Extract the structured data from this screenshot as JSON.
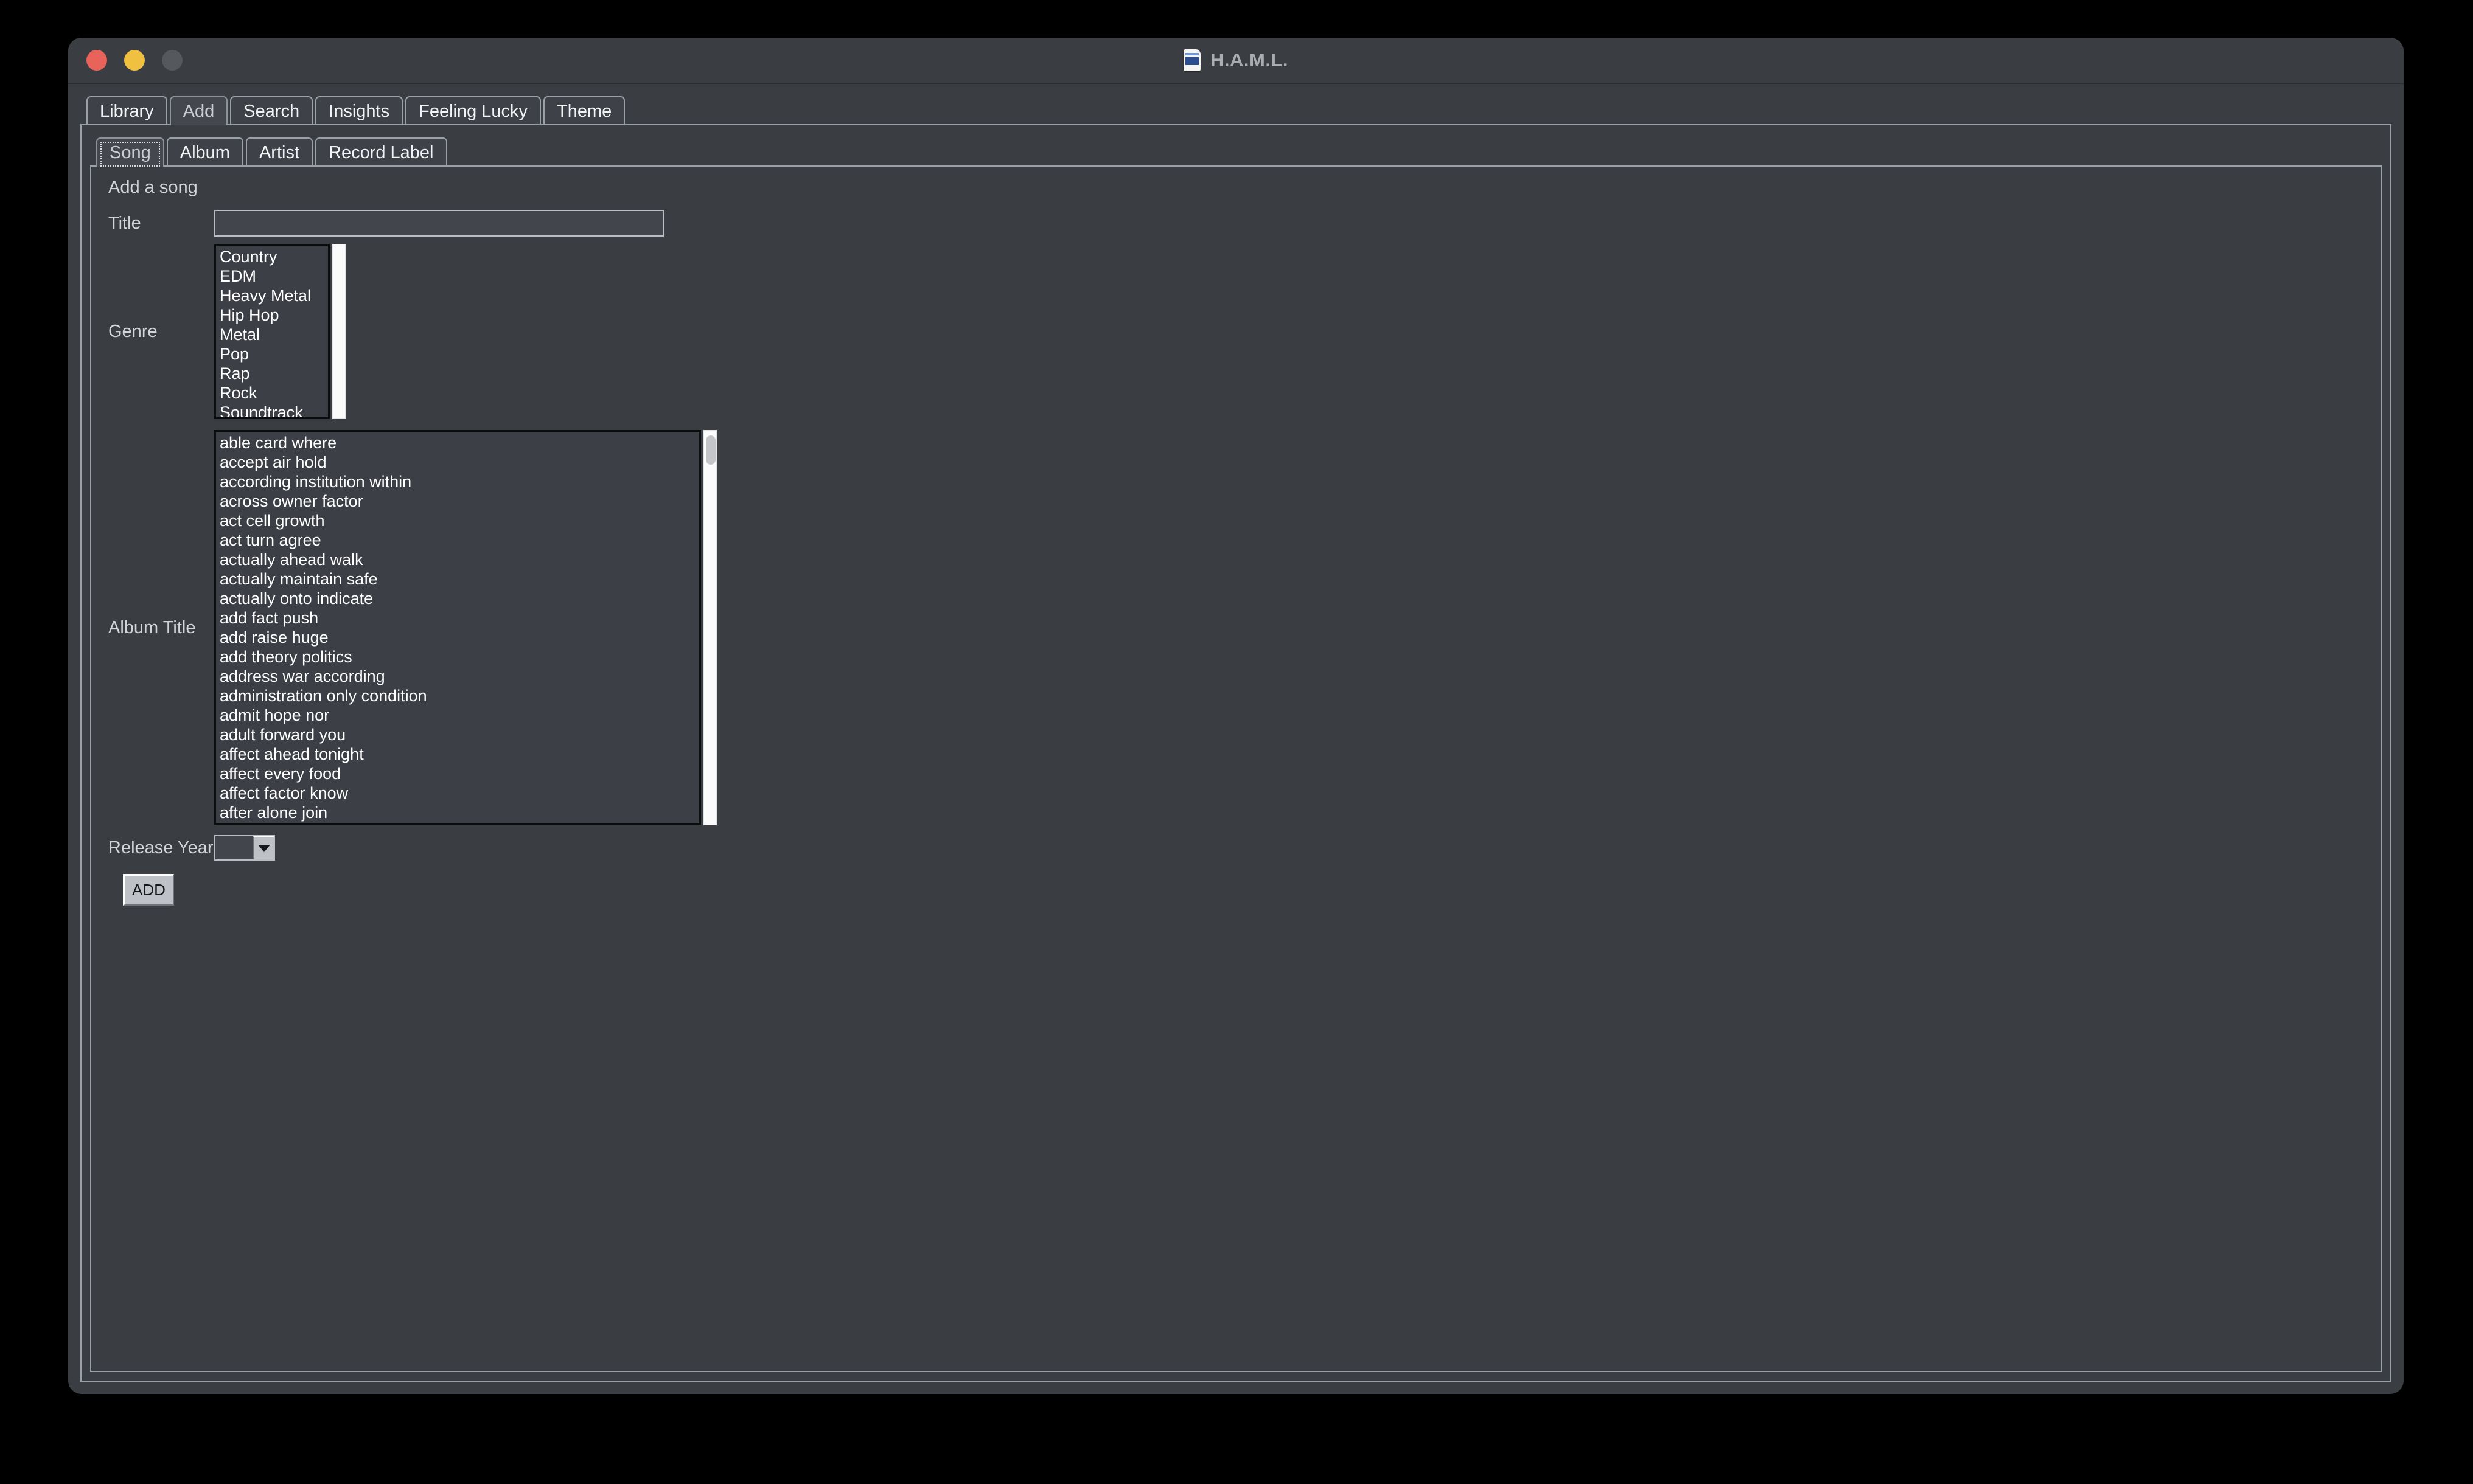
{
  "window": {
    "title": "H.A.M.L.",
    "icon": "document-icon",
    "controls": {
      "close": "close-button",
      "minimize": "minimize-button",
      "zoom": "zoom-button"
    },
    "colors": {
      "close": "#e8635a",
      "minimize": "#f0c040",
      "zoom": "#55585c",
      "background": "#3a3d42",
      "listbox_background": "#3c3f45",
      "button_face": "#bec2c6",
      "text": "#f2f3f4"
    }
  },
  "main_tabs": {
    "items": [
      {
        "label": "Library",
        "active": false
      },
      {
        "label": "Add",
        "active": true
      },
      {
        "label": "Search",
        "active": false
      },
      {
        "label": "Insights",
        "active": false
      },
      {
        "label": "Feeling Lucky",
        "active": false
      },
      {
        "label": "Theme",
        "active": false
      }
    ]
  },
  "sub_tabs": {
    "items": [
      {
        "label": "Song",
        "active": true,
        "focused": true
      },
      {
        "label": "Album",
        "active": false,
        "focused": false
      },
      {
        "label": "Artist",
        "active": false,
        "focused": false
      },
      {
        "label": "Record Label",
        "active": false,
        "focused": false
      }
    ]
  },
  "form": {
    "section_label": "Add a song",
    "title_field": {
      "label": "Title",
      "value": "",
      "placeholder": ""
    },
    "genre_field": {
      "label": "Genre",
      "options": [
        "Country",
        "EDM",
        "Heavy Metal",
        "Hip Hop",
        "Metal",
        "Pop",
        "Rap",
        "Rock",
        "Soundtrack"
      ],
      "selected": ""
    },
    "album_field": {
      "label": "Album Title",
      "options": [
        "able card where",
        "accept air hold",
        "according institution within",
        "across owner factor",
        "act cell growth",
        "act turn agree",
        "actually ahead walk",
        "actually maintain safe",
        "actually onto indicate",
        "add fact push",
        "add raise huge",
        "add theory politics",
        "address war according",
        "administration only condition",
        "admit hope nor",
        "adult forward you",
        "affect ahead tonight",
        "affect every food",
        "affect factor know",
        "after alone join"
      ],
      "selected": ""
    },
    "release_year_field": {
      "label": "Release Year",
      "value": "",
      "arrow_icon": "chevron-down-icon"
    },
    "submit_button": {
      "label": "ADD"
    }
  }
}
